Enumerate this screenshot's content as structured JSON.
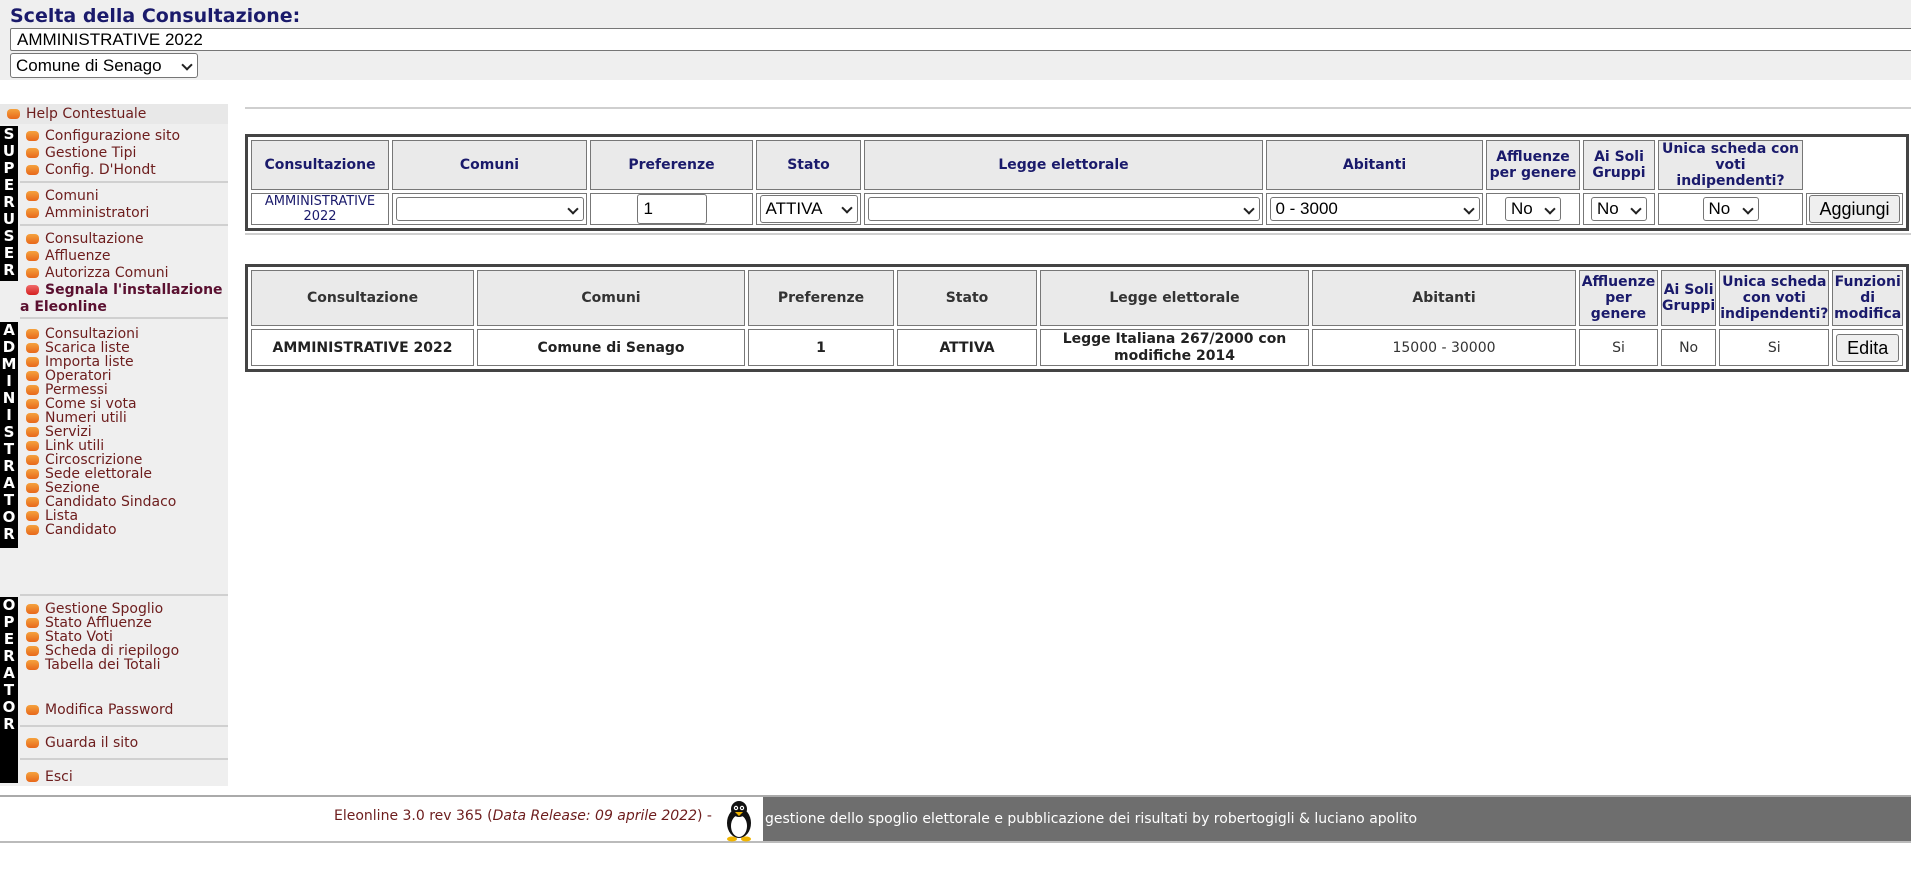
{
  "header": {
    "title": "Scelta della Consultazione:",
    "consultazione_selected": "AMMINISTRATIVE 2022",
    "comune_selected": "Comune di Senago"
  },
  "sidebar": {
    "help": "Help Contestuale",
    "superuser_letters": [
      "S",
      "U",
      "P",
      "E",
      "R",
      "U",
      "S",
      "E",
      "R"
    ],
    "admin_letters": [
      "A",
      "D",
      "M",
      "I",
      "N",
      "I",
      "S",
      "T",
      "R",
      "A",
      "T",
      "O",
      "R"
    ],
    "operator_letters": [
      "O",
      "P",
      "E",
      "R",
      "A",
      "T",
      "O",
      "R"
    ],
    "group1": [
      "Configurazione sito",
      "Gestione Tipi",
      "Config. D'Hondt"
    ],
    "group2": [
      "Comuni",
      "Amministratori"
    ],
    "group3": [
      "Consultazione",
      "Affluenze",
      "Autorizza Comuni"
    ],
    "segnala_line1": "Segnala l'installazione",
    "segnala_line2": "a Eleonline",
    "group4": [
      "Consultazioni",
      "Scarica liste",
      "Importa liste",
      "Operatori",
      "Permessi",
      "Come si vota",
      "Numeri utili",
      "Servizi",
      "Link utili",
      "Circoscrizione",
      "Sede elettorale",
      "Sezione",
      "Candidato Sindaco",
      "Lista",
      "Candidato"
    ],
    "group5": [
      "Gestione Spoglio",
      "Stato Affluenze",
      "Stato Voti",
      "Scheda di riepilogo",
      "Tabella dei Totali"
    ],
    "modifica_password": "Modifica Password",
    "guarda_sito": "Guarda il sito",
    "esci": "Esci"
  },
  "form_table": {
    "headers": {
      "consultazione": "Consultazione",
      "comuni": "Comuni",
      "preferenze": "Preferenze",
      "stato": "Stato",
      "legge": "Legge elettorale",
      "abitanti": "Abitanti",
      "affluenze": "Affluenze per genere",
      "soli_gruppi": "Ai Soli Gruppi",
      "unica": "Unica scheda con voti indipendenti?"
    },
    "row": {
      "consultazione": "AMMINISTRATIVE 2022",
      "comuni": "",
      "preferenze": "1",
      "stato": "ATTIVA",
      "legge": "",
      "abitanti": "0 - 3000",
      "affluenze": "No",
      "soli_gruppi": "No",
      "unica": "No",
      "add_button": "Aggiungi"
    }
  },
  "list_table": {
    "headers": {
      "consultazione": "Consultazione",
      "comuni": "Comuni",
      "preferenze": "Preferenze",
      "stato": "Stato",
      "legge": "Legge elettorale",
      "abitanti": "Abitanti",
      "affluenze": "Affluenze per genere",
      "soli_gruppi": "Ai Soli Gruppi",
      "unica": "Unica scheda con voti indipendenti?",
      "funzioni": "Funzioni di modifica"
    },
    "row": {
      "consultazione": "AMMINISTRATIVE 2022",
      "comuni": "Comune di Senago",
      "preferenze": "1",
      "stato": "ATTIVA",
      "legge": "Legge Italiana 267/2000 con modifiche 2014",
      "abitanti": "15000 - 30000",
      "affluenze": "Si",
      "soli_gruppi": "No",
      "unica": "Si",
      "edit_button": "Edita"
    }
  },
  "footer": {
    "version": "Eleonline 3.0 rev 365 (",
    "release": "Data Release: 09 aprile 2022",
    "version_end": ") - ",
    "credits": "gestione dello spoglio elettorale e pubblicazione dei risultati by robertogigli & luciano apolito"
  }
}
